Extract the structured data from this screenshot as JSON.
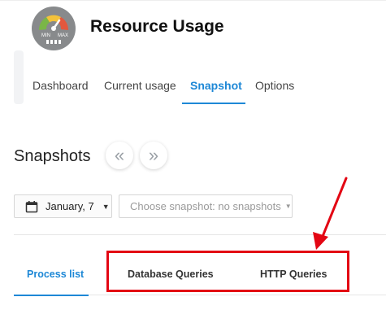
{
  "app": {
    "title": "Resource Usage",
    "logo": {
      "icon": "gauge-icon",
      "min_label": "MIN",
      "max_label": "MAX"
    }
  },
  "nav": {
    "tabs": [
      {
        "label": "Dashboard",
        "active": false
      },
      {
        "label": "Current usage",
        "active": false
      },
      {
        "label": "Snapshot",
        "active": true
      },
      {
        "label": "Options",
        "active": false
      }
    ]
  },
  "snapshots": {
    "title": "Snapshots",
    "prev_icon": "double-chevron-left-icon",
    "next_icon": "double-chevron-right-icon",
    "prev_glyph": "«",
    "next_glyph": "»"
  },
  "filters": {
    "date": {
      "icon": "calendar-icon",
      "value": "January, 7",
      "caret": "▼"
    },
    "snapshot_select": {
      "placeholder": "Choose snapshot: no snapshots",
      "caret": "▼"
    }
  },
  "sub_tabs": [
    {
      "label": "Process list",
      "active": true
    },
    {
      "label": "Database Queries",
      "active": false
    },
    {
      "label": "HTTP Queries",
      "active": false
    }
  ],
  "annotation": {
    "color": "#e30613"
  },
  "colors": {
    "accent": "#1e88d6",
    "annotation": "#e30613"
  }
}
